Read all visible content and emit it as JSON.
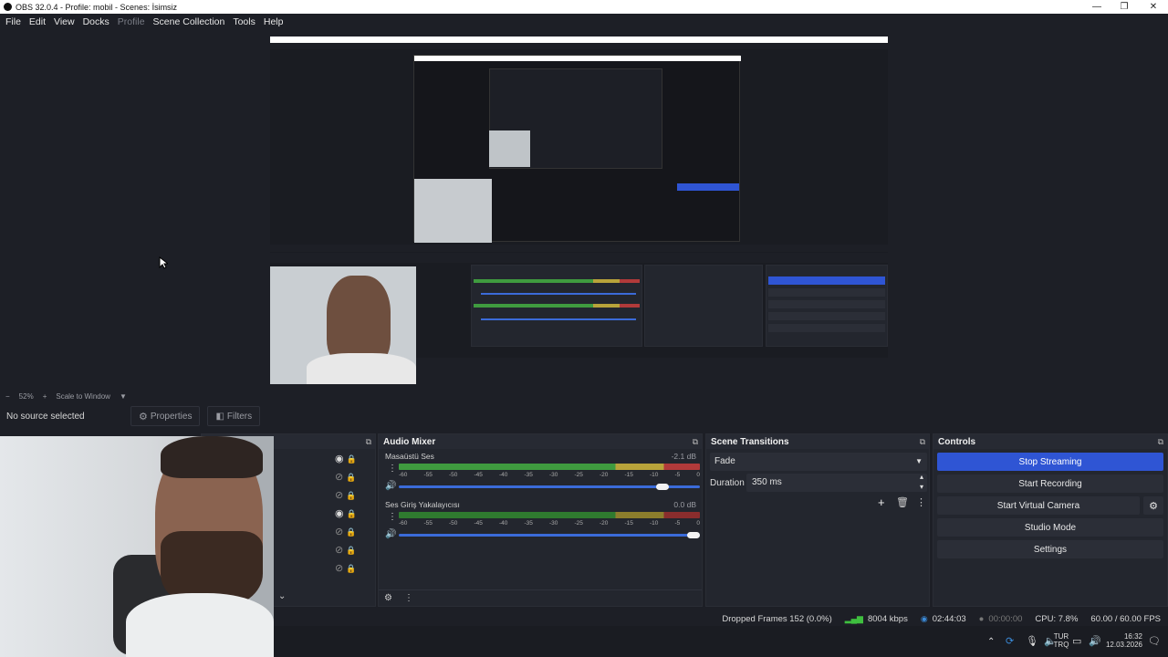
{
  "window": {
    "title": "OBS 32.0.4 - Profile: mobil - Scenes: İsimsiz",
    "controls": [
      "—",
      "❐",
      "✕"
    ]
  },
  "menu": [
    "File",
    "Edit",
    "View",
    "Docks",
    "Profile",
    "Scene Collection",
    "Tools",
    "Help"
  ],
  "zoom": {
    "minus": "−",
    "percent": "52%",
    "plus": "+",
    "mode": "Scale to Window"
  },
  "source_toolbar": {
    "no_source": "No source selected",
    "properties": "Properties",
    "filters": "Filters"
  },
  "audio_mixer": {
    "title": "Audio Mixer",
    "channels": [
      {
        "name": "Masaüstü Ses",
        "db": "-2.1 dB"
      },
      {
        "name": "Ses Giriş Yakalayıcısı",
        "db": "0.0 dB"
      }
    ],
    "ticks": [
      "-60",
      "-55",
      "-50",
      "-45",
      "-40",
      "-35",
      "-30",
      "-25",
      "-20",
      "-15",
      "-10",
      "-5",
      "0"
    ]
  },
  "scene_transitions": {
    "title": "Scene Transitions",
    "transition": "Fade",
    "duration_label": "Duration",
    "duration_value": "350 ms"
  },
  "controls": {
    "title": "Controls",
    "stop_streaming": "Stop Streaming",
    "start_recording": "Start Recording",
    "start_virtual_camera": "Start Virtual Camera",
    "studio_mode": "Studio Mode",
    "settings": "Settings"
  },
  "status": {
    "dropped_frames": "Dropped Frames 152 (0.0%)",
    "bitrate": "8004 kbps",
    "stream_time": "02:44:03",
    "rec_time": "00:00:00",
    "cpu": "CPU: 7.8%",
    "fps": "60.00 / 60.00 FPS"
  },
  "taskbar": {
    "lang_top": "TUR",
    "lang_bottom": "TRQ",
    "time": "16:32",
    "date": "12.03.2026"
  },
  "colors": {
    "accent": "#2f55d4",
    "meter_green": "#3f9b3f",
    "meter_yellow": "#b8a33a",
    "meter_red": "#b13a3a"
  }
}
